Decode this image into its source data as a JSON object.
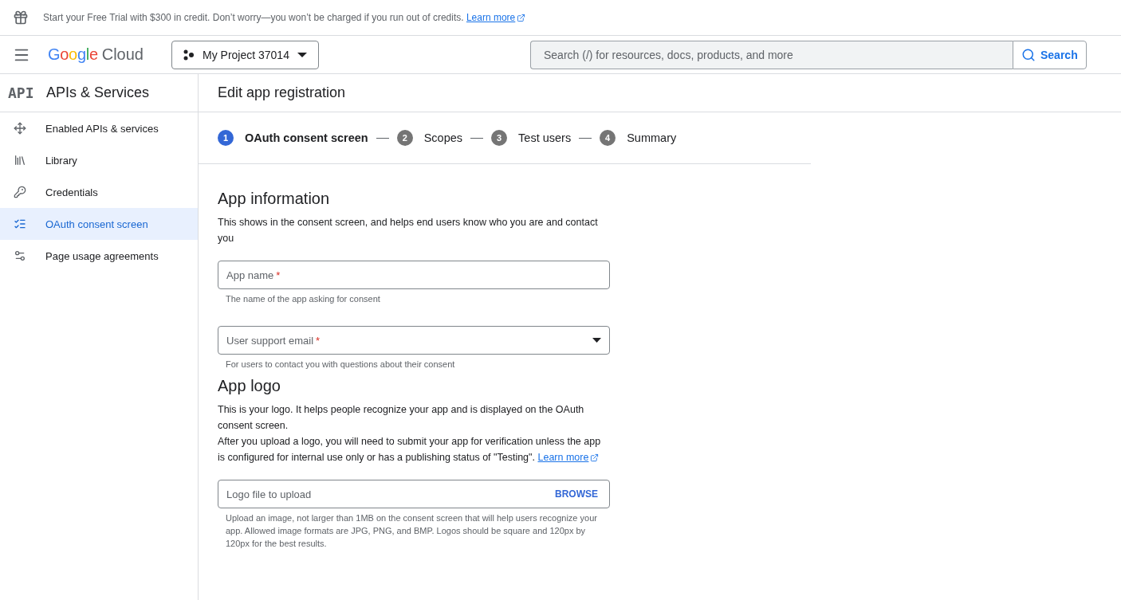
{
  "banner": {
    "text": "Start your Free Trial with $300 in credit. Don’t worry—you won’t be charged if you run out of credits.",
    "link": "Learn more"
  },
  "header": {
    "logo": {
      "word": "Google",
      "product": "Cloud"
    },
    "project": "My Project 37014",
    "search": {
      "placeholder": "Search (/) for resources, docs, products, and more",
      "button": "Search"
    }
  },
  "sidebar": {
    "badge": "API",
    "title": "APIs & Services",
    "items": [
      {
        "label": "Enabled APIs & services",
        "selected": false
      },
      {
        "label": "Library",
        "selected": false
      },
      {
        "label": "Credentials",
        "selected": false
      },
      {
        "label": "OAuth consent screen",
        "selected": true
      },
      {
        "label": "Page usage agreements",
        "selected": false
      }
    ]
  },
  "page_title": "Edit app registration",
  "steps": [
    {
      "number": "1",
      "label": "OAuth consent screen",
      "selected": true
    },
    {
      "number": "2",
      "label": "Scopes",
      "selected": false
    },
    {
      "number": "3",
      "label": "Test users",
      "selected": false
    },
    {
      "number": "4",
      "label": "Summary",
      "selected": false
    }
  ],
  "sections": [
    {
      "title": "App information",
      "paragraphs": [
        {
          "text": "This shows in the consent screen, and helps end users know who you are and contact you"
        }
      ],
      "fields": [
        {
          "kind": "text",
          "placeholder": "App name",
          "required_mark": "*",
          "hint": "The name of the app asking for consent"
        },
        {
          "kind": "select",
          "placeholder": "User support email",
          "required_mark": "*",
          "hint": "For users to contact you with questions about their consent"
        }
      ]
    },
    {
      "title": "App logo",
      "paragraphs": [
        {
          "text": "This is your logo. It helps people recognize your app and is displayed on the OAuth consent screen."
        },
        {
          "text": "After you upload a logo, you will need to submit your app for verification unless the app is configured for internal use only or has a publishing status of \"Testing\".",
          "link": "Learn more"
        }
      ],
      "fields": [
        {
          "kind": "file",
          "placeholder": "Logo file to upload",
          "button": "BROWSE",
          "hint": "Upload an image, not larger than 1MB on the consent screen that will help users recognize your app. Allowed image formats are JPG, PNG, and BMP. Logos should be square and 120px by 120px for the best results."
        }
      ]
    }
  ]
}
